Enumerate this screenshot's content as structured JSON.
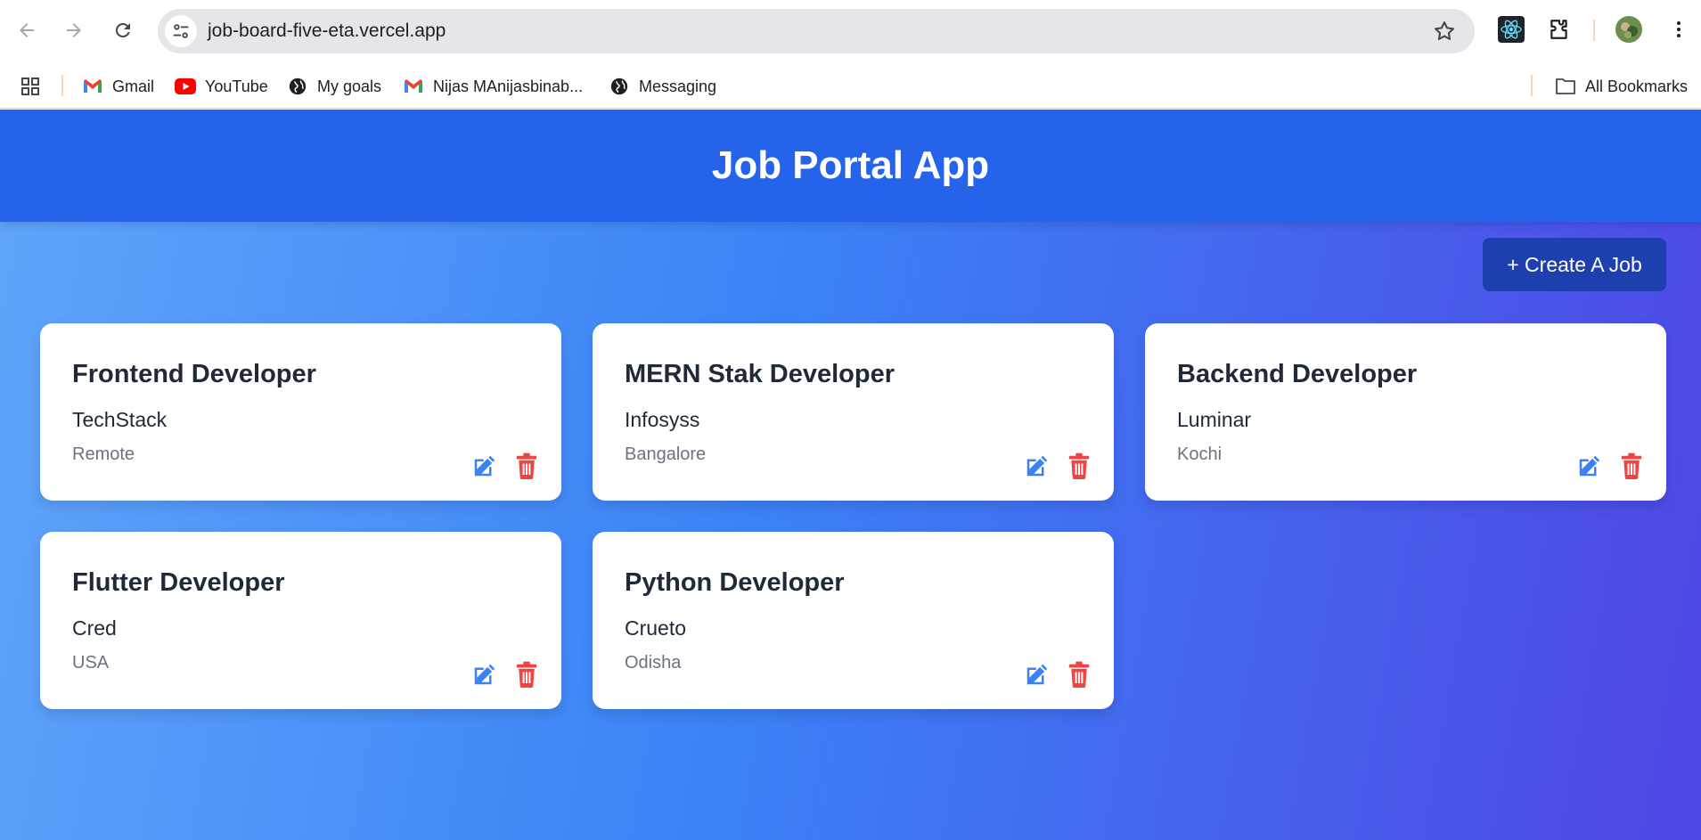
{
  "browser": {
    "url": "job-board-five-eta.vercel.app",
    "bookmarks": [
      {
        "label": "Gmail",
        "icon": "gmail-icon"
      },
      {
        "label": "YouTube",
        "icon": "youtube-icon"
      },
      {
        "label": "My goals",
        "icon": "globe-icon"
      },
      {
        "label": "Nijas MAnijasbinab...",
        "icon": "gmail-icon"
      },
      {
        "label": "Messaging",
        "icon": "globe-icon"
      }
    ],
    "all_bookmarks_label": "All Bookmarks"
  },
  "app": {
    "title": "Job Portal App",
    "create_button": "+ Create A Job",
    "jobs": [
      {
        "title": "Frontend Developer",
        "company": "TechStack",
        "location": "Remote"
      },
      {
        "title": "MERN Stak Developer",
        "company": "Infosyss",
        "location": "Bangalore"
      },
      {
        "title": "Backend Developer",
        "company": "Luminar",
        "location": "Kochi"
      },
      {
        "title": "Flutter Developer",
        "company": "Cred",
        "location": "USA"
      },
      {
        "title": "Python Developer",
        "company": "Crueto",
        "location": "Odisha"
      }
    ]
  },
  "colors": {
    "header": "#2563eb",
    "button": "#1e40af",
    "edit": "#3b82f6",
    "delete": "#ef4444"
  }
}
